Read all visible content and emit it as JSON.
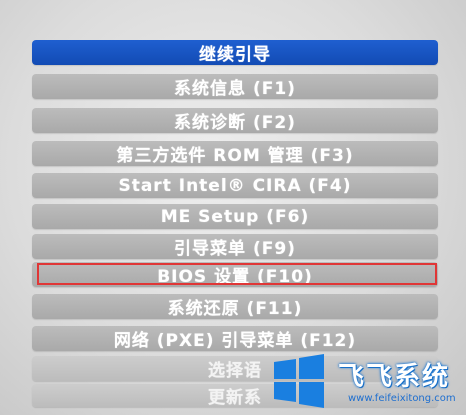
{
  "boot_menu": {
    "items": [
      {
        "label": "继续引导",
        "state": "selected"
      },
      {
        "label": "系统信息 (F1)",
        "state": "normal"
      },
      {
        "label": "系统诊断 (F2)",
        "state": "normal"
      },
      {
        "label": "第三方选件 ROM 管理 (F3)",
        "state": "normal"
      },
      {
        "label": "Start Intel® CIRA (F4)",
        "state": "normal"
      },
      {
        "label": "ME Setup (F6)",
        "state": "normal"
      },
      {
        "label": "引导菜单 (F9)",
        "state": "normal"
      },
      {
        "label": "BIOS 设置 (F10)",
        "state": "highlighted"
      },
      {
        "label": "系统还原 (F11)",
        "state": "normal"
      },
      {
        "label": "网络 (PXE) 引导菜单 (F12)",
        "state": "normal"
      },
      {
        "label": "选择语",
        "state": "faded"
      },
      {
        "label": "更新系",
        "state": "faded"
      }
    ],
    "highlight_color": "#e03636",
    "selected_color": "#1f5fd0"
  },
  "watermark": {
    "brand": "飞飞系统",
    "url": "www.feifeixitong.com",
    "logo_icon": "windows-logo-icon"
  }
}
